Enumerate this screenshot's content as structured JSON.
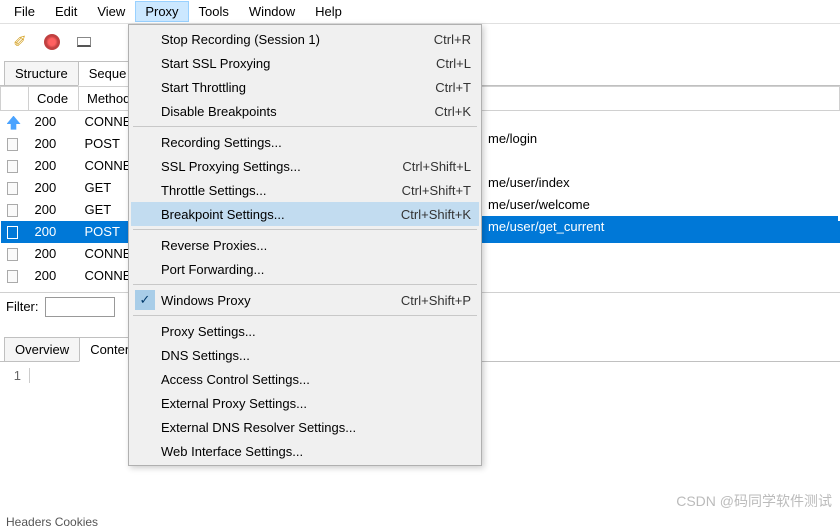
{
  "menubar": [
    "File",
    "Edit",
    "View",
    "Proxy",
    "Tools",
    "Window",
    "Help"
  ],
  "menubar_active_index": 3,
  "toolbar": {
    "broom": "clear",
    "record": "record",
    "device": "device-view"
  },
  "structure_tabs": [
    "Structure",
    "Sequence"
  ],
  "structure_tabs_active": 1,
  "columns": [
    "",
    "Code",
    "Method"
  ],
  "rows": [
    {
      "icon": "up",
      "code": "200",
      "method": "CONNE",
      "selected": false
    },
    {
      "icon": "doc",
      "code": "200",
      "method": "POST",
      "selected": false
    },
    {
      "icon": "doc",
      "code": "200",
      "method": "CONNE",
      "selected": false
    },
    {
      "icon": "doc",
      "code": "200",
      "method": "GET",
      "selected": false
    },
    {
      "icon": "doc",
      "code": "200",
      "method": "GET",
      "selected": false
    },
    {
      "icon": "sel",
      "code": "200",
      "method": "POST",
      "selected": true
    },
    {
      "icon": "doc",
      "code": "200",
      "method": "CONNE",
      "selected": false
    },
    {
      "icon": "doc",
      "code": "200",
      "method": "CONNE",
      "selected": false
    }
  ],
  "right_items": [
    {
      "text": "me/login",
      "selected": false
    },
    {
      "text": "",
      "selected": false
    },
    {
      "text": "me/user/index",
      "selected": false
    },
    {
      "text": "me/user/welcome",
      "selected": false
    },
    {
      "text": "me/user/get_current",
      "selected": true
    }
  ],
  "filter_label": "Filter:",
  "filter_value": "",
  "overview_tabs": [
    "Overview",
    "Contents"
  ],
  "overview_tabs_active": 1,
  "line_number": "1",
  "footer_tabs_text": "Headers    Cookies",
  "dropdown": {
    "groups": [
      [
        {
          "label": "Stop Recording (Session 1)",
          "shortcut": "Ctrl+R"
        },
        {
          "label": "Start SSL Proxying",
          "shortcut": "Ctrl+L"
        },
        {
          "label": "Start Throttling",
          "shortcut": "Ctrl+T"
        },
        {
          "label": "Disable Breakpoints",
          "shortcut": "Ctrl+K"
        }
      ],
      [
        {
          "label": "Recording Settings...",
          "shortcut": ""
        },
        {
          "label": "SSL Proxying Settings...",
          "shortcut": "Ctrl+Shift+L"
        },
        {
          "label": "Throttle Settings...",
          "shortcut": "Ctrl+Shift+T"
        },
        {
          "label": "Breakpoint Settings...",
          "shortcut": "Ctrl+Shift+K",
          "highlight": true
        }
      ],
      [
        {
          "label": "Reverse Proxies...",
          "shortcut": ""
        },
        {
          "label": "Port Forwarding...",
          "shortcut": ""
        }
      ],
      [
        {
          "label": "Windows Proxy",
          "shortcut": "Ctrl+Shift+P",
          "checked": true
        }
      ],
      [
        {
          "label": "Proxy Settings...",
          "shortcut": ""
        },
        {
          "label": "DNS Settings...",
          "shortcut": ""
        },
        {
          "label": "Access Control Settings...",
          "shortcut": ""
        },
        {
          "label": "External Proxy Settings...",
          "shortcut": ""
        },
        {
          "label": "External DNS Resolver Settings...",
          "shortcut": ""
        },
        {
          "label": "Web Interface Settings...",
          "shortcut": ""
        }
      ]
    ]
  },
  "watermark": "CSDN @码同学软件测试"
}
